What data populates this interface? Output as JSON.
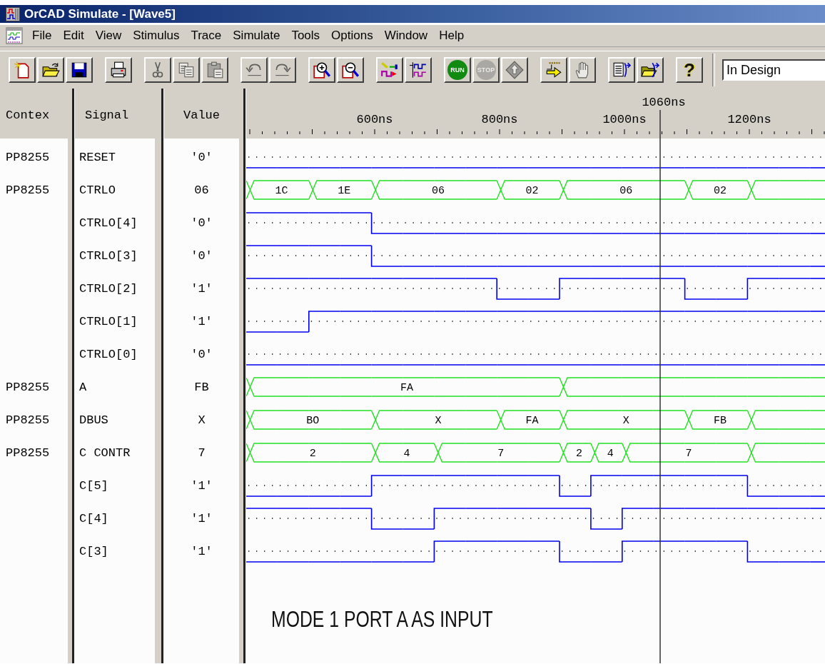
{
  "window": {
    "title": "OrCAD Simulate - [Wave5]"
  },
  "menu": [
    "File",
    "Edit",
    "View",
    "Stimulus",
    "Trace",
    "Simulate",
    "Tools",
    "Options",
    "Window",
    "Help"
  ],
  "toolbar": [
    {
      "buttons": [
        {
          "disabled": false
        },
        {
          "disabled": false
        },
        {
          "disabled": false
        }
      ]
    },
    {
      "buttons": [
        {
          "disabled": false
        }
      ]
    },
    {
      "buttons": [
        {
          "disabled": true
        },
        {
          "disabled": true
        },
        {
          "disabled": true
        }
      ]
    },
    {
      "buttons": [
        {
          "disabled": true
        },
        {
          "disabled": true
        }
      ]
    },
    {
      "buttons": [
        {
          "disabled": false
        },
        {
          "disabled": false
        }
      ]
    },
    {
      "buttons": [
        {
          "disabled": false
        },
        {
          "disabled": false
        }
      ]
    },
    {
      "buttons": [
        {
          "label": "RUN",
          "disabled": false
        },
        {
          "label": "STOP",
          "disabled": true
        },
        {
          "disabled": true
        }
      ]
    },
    {
      "buttons": [
        {
          "disabled": false
        },
        {
          "disabled": true
        }
      ]
    },
    {
      "buttons": [
        {
          "disabled": false
        },
        {
          "disabled": false
        }
      ]
    },
    {
      "buttons": [
        {
          "label": "?",
          "disabled": false
        }
      ]
    }
  ],
  "mode_select": {
    "value": "In Design"
  },
  "columns": [
    "Contex",
    "Signal",
    "Value"
  ],
  "ruler": {
    "labels": [
      "600ns",
      "800ns",
      "1000ns",
      "1200ns"
    ],
    "cursor": "1060ns"
  },
  "signals": [
    {
      "context": "PP8255",
      "name": "RESET",
      "value": "'0'",
      "kind": "bit",
      "cells": [
        {
          "high": false
        },
        {
          "high": false
        },
        {
          "high": false
        },
        {
          "high": false
        },
        {
          "high": false
        },
        {
          "high": false
        },
        {
          "high": false
        },
        {
          "high": false
        },
        {
          "high": false
        },
        {
          "high": false
        },
        {
          "high": false
        },
        {
          "high": false
        },
        {
          "high": false
        },
        {
          "high": false
        },
        {
          "high": false
        },
        {
          "high": false
        },
        {
          "high": false
        },
        {
          "high": false
        },
        {
          "high": false
        }
      ]
    },
    {
      "context": "PP8255",
      "name": "CTRLO",
      "value": "06",
      "kind": "bus",
      "cells": [
        {
          "start": true,
          "label": "1C"
        },
        {
          "start": false
        },
        {
          "start": true,
          "label": "1E"
        },
        {
          "start": false
        },
        {
          "start": true,
          "label": "06"
        },
        {
          "start": false
        },
        {
          "start": false
        },
        {
          "start": false
        },
        {
          "start": true,
          "label": "02"
        },
        {
          "start": false
        },
        {
          "start": true,
          "label": "06"
        },
        {
          "start": false
        },
        {
          "start": false
        },
        {
          "start": false
        },
        {
          "start": true,
          "label": "02"
        },
        {
          "start": false
        },
        {
          "start": true
        },
        {
          "start": false
        },
        {
          "start": false
        }
      ]
    },
    {
      "name": "CTRLO[4]",
      "value": "'0'",
      "kind": "bit",
      "cells": [
        {
          "high": true
        },
        {
          "high": true
        },
        {
          "high": true
        },
        {
          "high": true
        },
        {
          "high": false
        },
        {
          "high": false
        },
        {
          "high": false
        },
        {
          "high": false
        },
        {
          "high": false
        },
        {
          "high": false
        },
        {
          "high": false
        },
        {
          "high": false
        },
        {
          "high": false
        },
        {
          "high": false
        },
        {
          "high": false
        },
        {
          "high": false
        },
        {
          "high": false
        },
        {
          "high": false
        },
        {
          "high": false
        }
      ]
    },
    {
      "name": "CTRLO[3]",
      "value": "'0'",
      "kind": "bit",
      "cells": [
        {
          "high": true
        },
        {
          "high": true
        },
        {
          "high": true
        },
        {
          "high": true
        },
        {
          "high": false
        },
        {
          "high": false
        },
        {
          "high": false
        },
        {
          "high": false
        },
        {
          "high": false
        },
        {
          "high": false
        },
        {
          "high": false
        },
        {
          "high": false
        },
        {
          "high": false
        },
        {
          "high": false
        },
        {
          "high": false
        },
        {
          "high": false
        },
        {
          "high": false
        },
        {
          "high": false
        },
        {
          "high": false
        }
      ]
    },
    {
      "name": "CTRLO[2]",
      "value": "'1'",
      "kind": "bit",
      "cells": [
        {
          "high": true
        },
        {
          "high": true
        },
        {
          "high": true
        },
        {
          "high": true
        },
        {
          "high": true
        },
        {
          "high": true
        },
        {
          "high": true
        },
        {
          "high": true
        },
        {
          "high": false
        },
        {
          "high": false
        },
        {
          "high": true
        },
        {
          "high": true
        },
        {
          "high": true
        },
        {
          "high": true
        },
        {
          "high": false
        },
        {
          "high": false
        },
        {
          "high": true
        },
        {
          "high": true
        },
        {
          "high": true
        }
      ]
    },
    {
      "name": "CTRLO[1]",
      "value": "'1'",
      "kind": "bit",
      "cells": [
        {
          "high": false
        },
        {
          "high": false
        },
        {
          "high": true
        },
        {
          "high": true
        },
        {
          "high": true
        },
        {
          "high": true
        },
        {
          "high": true
        },
        {
          "high": true
        },
        {
          "high": true
        },
        {
          "high": true
        },
        {
          "high": true
        },
        {
          "high": true
        },
        {
          "high": true
        },
        {
          "high": true
        },
        {
          "high": true
        },
        {
          "high": true
        },
        {
          "high": true
        },
        {
          "high": true
        },
        {
          "high": true
        }
      ]
    },
    {
      "name": "CTRLO[0]",
      "value": "'0'",
      "kind": "bit",
      "cells": [
        {
          "high": false
        },
        {
          "high": false
        },
        {
          "high": false
        },
        {
          "high": false
        },
        {
          "high": false
        },
        {
          "high": false
        },
        {
          "high": false
        },
        {
          "high": false
        },
        {
          "high": false
        },
        {
          "high": false
        },
        {
          "high": false
        },
        {
          "high": false
        },
        {
          "high": false
        },
        {
          "high": false
        },
        {
          "high": false
        },
        {
          "high": false
        },
        {
          "high": false
        },
        {
          "high": false
        },
        {
          "high": false
        }
      ]
    },
    {
      "context": "PP8255",
      "name": "A",
      "value": "FB",
      "kind": "bus",
      "cells": [
        {
          "start": true,
          "label": "FA"
        },
        {
          "start": false
        },
        {
          "start": false
        },
        {
          "start": false
        },
        {
          "start": false
        },
        {
          "start": false
        },
        {
          "start": false
        },
        {
          "start": false
        },
        {
          "start": false
        },
        {
          "start": false
        },
        {
          "start": true
        },
        {
          "start": false
        },
        {
          "start": false
        },
        {
          "start": false
        },
        {
          "start": false
        },
        {
          "start": false
        },
        {
          "start": false
        },
        {
          "start": false
        },
        {
          "start": false
        }
      ]
    },
    {
      "context": "PP8255",
      "name": "DBUS",
      "value": "X",
      "kind": "bus",
      "cells": [
        {
          "start": true,
          "label": "BO"
        },
        {
          "start": false
        },
        {
          "start": false
        },
        {
          "start": false
        },
        {
          "start": true,
          "label": "X"
        },
        {
          "start": false
        },
        {
          "start": false
        },
        {
          "start": false
        },
        {
          "start": true,
          "label": "FA"
        },
        {
          "start": false
        },
        {
          "start": true,
          "label": "X"
        },
        {
          "start": false
        },
        {
          "start": false
        },
        {
          "start": false
        },
        {
          "start": true,
          "label": "FB"
        },
        {
          "start": false
        },
        {
          "start": true
        },
        {
          "start": false
        },
        {
          "start": false
        }
      ]
    },
    {
      "context": "PP8255",
      "name": "C CONTR",
      "value": "7",
      "kind": "bus",
      "cells": [
        {
          "start": true,
          "label": "2"
        },
        {
          "start": false
        },
        {
          "start": false
        },
        {
          "start": false
        },
        {
          "start": true,
          "label": "4"
        },
        {
          "start": false
        },
        {
          "start": true,
          "label": "7"
        },
        {
          "start": false
        },
        {
          "start": false
        },
        {
          "start": false
        },
        {
          "start": true,
          "label": "2"
        },
        {
          "start": true,
          "label": "4"
        },
        {
          "start": true,
          "label": "7"
        },
        {
          "start": false
        },
        {
          "start": false
        },
        {
          "start": false
        },
        {
          "start": true
        },
        {
          "start": false
        },
        {
          "start": false
        }
      ]
    },
    {
      "name": "C[5]",
      "value": "'1'",
      "kind": "bit",
      "cells": [
        {
          "high": false
        },
        {
          "high": false
        },
        {
          "high": false
        },
        {
          "high": false
        },
        {
          "high": true
        },
        {
          "high": true
        },
        {
          "high": true
        },
        {
          "high": true
        },
        {
          "high": true
        },
        {
          "high": true
        },
        {
          "high": false
        },
        {
          "high": true
        },
        {
          "high": true
        },
        {
          "high": true
        },
        {
          "high": true
        },
        {
          "high": true
        },
        {
          "high": false
        },
        {
          "high": false
        },
        {
          "high": false
        }
      ]
    },
    {
      "name": "C[4]",
      "value": "'1'",
      "kind": "bit",
      "cells": [
        {
          "high": true
        },
        {
          "high": true
        },
        {
          "high": true
        },
        {
          "high": true
        },
        {
          "high": false
        },
        {
          "high": false
        },
        {
          "high": true
        },
        {
          "high": true
        },
        {
          "high": true
        },
        {
          "high": true
        },
        {
          "high": true
        },
        {
          "high": false
        },
        {
          "high": true
        },
        {
          "high": true
        },
        {
          "high": true
        },
        {
          "high": true
        },
        {
          "high": true
        },
        {
          "high": true
        },
        {
          "high": true
        }
      ]
    },
    {
      "name": "C[3]",
      "value": "'1'",
      "kind": "bit",
      "cells": [
        {
          "high": false
        },
        {
          "high": false
        },
        {
          "high": false
        },
        {
          "high": false
        },
        {
          "high": false
        },
        {
          "high": false
        },
        {
          "high": true
        },
        {
          "high": true
        },
        {
          "high": true
        },
        {
          "high": true
        },
        {
          "high": false
        },
        {
          "high": false
        },
        {
          "high": true
        },
        {
          "high": true
        },
        {
          "high": true
        },
        {
          "high": true
        },
        {
          "high": false
        },
        {
          "high": false
        },
        {
          "high": false
        }
      ]
    }
  ],
  "annotation": "MODE 1 PORT A AS INPUT"
}
